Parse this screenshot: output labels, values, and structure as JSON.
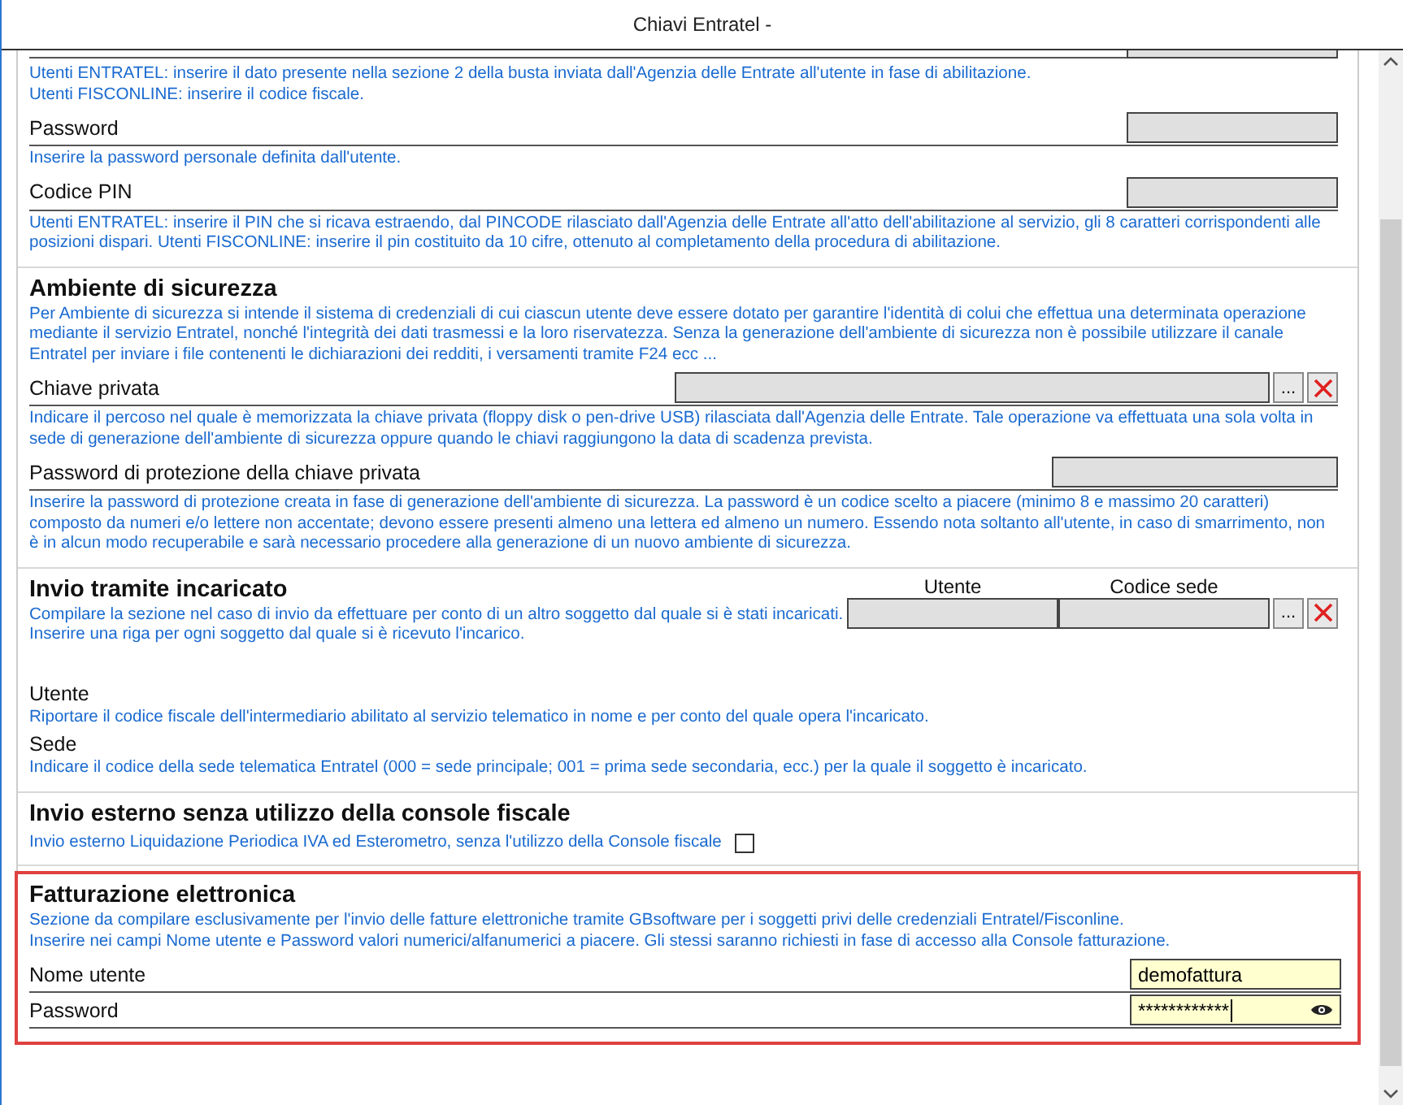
{
  "window": {
    "title": "Chiavi Entratel -"
  },
  "sections": [
    {
      "items": [
        {
          "kind": "help",
          "text": "Utenti ENTRATEL: inserire il dato presente nella sezione 2 della busta inviata dall'Agenzia delle Entrate all'utente in fase di abilitazione.\nUtenti FISCONLINE: inserire il codice fiscale."
        },
        {
          "kind": "short-field",
          "label": "Password"
        },
        {
          "kind": "help",
          "text": "Inserire la password personale definita dall'utente."
        },
        {
          "kind": "short-field",
          "label": "Codice PIN"
        },
        {
          "kind": "help",
          "text": "Utenti ENTRATEL: inserire il PIN che si ricava estraendo, dal PINCODE rilasciato dall'Agenzia delle Entrate all'atto dell'abilitazione al servizio, gli 8 caratteri corrispondenti alle posizioni dispari. Utenti FISCONLINE: inserire il pin costituito da 10 cifre, ottenuto al completamento della procedura di abilitazione."
        }
      ]
    },
    {
      "title": "Ambiente di sicurezza",
      "description": "Per Ambiente di sicurezza si intende il sistema di credenziali di cui ciascun utente deve essere dotato per garantire l'identità di colui che effettua una determinata operazione mediante il servizio Entratel, nonché l'integrità dei dati trasmessi e la loro riservatezza. Senza la generazione dell'ambiente di sicurezza non è possibile utilizzare il canale Entratel per inviare i file contenenti le dichiarazioni dei redditi, i versamenti tramite F24 ecc ...",
      "items": [
        {
          "kind": "file-field",
          "label": "Chiave privata",
          "browse": "..."
        },
        {
          "kind": "help",
          "text": "Indicare il percoso nel quale è memorizzata la chiave privata (floppy disk o pen-drive USB) rilasciata dall'Agenzia delle Entrate. Tale operazione va effettuata una sola volta in sede di generazione dell'ambiente di sicurezza oppure quando le chiavi raggiungono la data di scadenza prevista."
        },
        {
          "kind": "medium-field",
          "label": "Password di protezione della chiave privata"
        },
        {
          "kind": "help",
          "text": "Inserire la password di protezione creata in fase di generazione dell'ambiente di sicurezza. La password è un codice scelto a piacere (minimo 8 e massimo 20 caratteri) composto da numeri e/o lettere non accentate; devono essere presenti almeno una lettera ed almeno un numero. Essendo nota soltanto all'utente, in caso di smarrimento, non è in alcun modo recuperabile e sarà necessario procedere alla generazione di un nuovo ambiente di sicurezza."
        }
      ]
    },
    {
      "title": "Invio tramite incaricato",
      "description": "Compilare la sezione nel caso di invio da effettuare per conto di un altro soggetto dal quale si è stati incaricati.\nInserire una riga per ogni soggetto dal quale si è ricevuto l'incarico.",
      "grid": {
        "columns": [
          "Utente",
          "Codice sede"
        ],
        "browse": "..."
      },
      "items": [
        {
          "kind": "label",
          "label": "Utente"
        },
        {
          "kind": "help",
          "text": "Riportare il codice fiscale dell'intermediario abilitato al servizio telematico in nome e per conto del quale opera l'incaricato."
        },
        {
          "kind": "label",
          "label": "Sede"
        },
        {
          "kind": "help",
          "text": "Indicare il codice della sede telematica Entratel (000 = sede principale; 001 = prima sede secondaria, ecc.) per la quale il soggetto è incaricato."
        }
      ]
    },
    {
      "title": "Invio esterno senza utilizzo della console fiscale",
      "items": [
        {
          "kind": "checkbox",
          "text": "Invio esterno Liquidazione Periodica IVA ed Esterometro, senza l'utilizzo della Console fiscale",
          "checked": false
        }
      ]
    },
    {
      "title": "Fatturazione elettronica",
      "highlighted": true,
      "description": "Sezione da compilare esclusivamente per l'invio delle fatture elettroniche tramite GBsoftware per i soggetti privi delle credenziali Entratel/Fisconline.\nInserire nei campi Nome utente e Password valori numerici/alfanumerici a piacere. Gli stessi saranno richiesti in fase di accesso alla Console fatturazione.",
      "items": [
        {
          "kind": "short-field",
          "label": "Nome utente",
          "value": "demofattura",
          "focused": false,
          "masked": false
        },
        {
          "kind": "short-field",
          "label": "Password",
          "value": "************",
          "focused": true,
          "masked": true
        }
      ]
    }
  ]
}
